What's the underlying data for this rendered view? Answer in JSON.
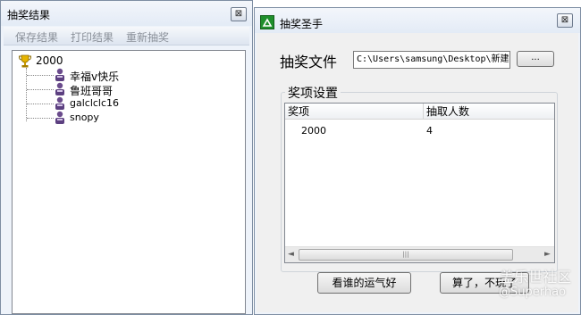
{
  "results_window": {
    "title": "抽奖结果",
    "close_glyph": "⊠",
    "menu": [
      "保存结果",
      "打印结果",
      "重新抽奖"
    ],
    "tree": {
      "root": "2000",
      "root_icon": "trophy-icon",
      "children": [
        "幸福v快乐",
        "鲁班哥哥",
        "galclclc16",
        "snopy"
      ],
      "child_icon": "user-icon"
    }
  },
  "main_window": {
    "title": "抽奖圣手",
    "close_glyph": "⊠",
    "file_label": "抽奖文件",
    "file_path": "C:\\Users\\samsung\\Desktop\\新建",
    "browse_label": "...",
    "group_title": "奖项设置",
    "columns": [
      "奖项",
      "抽取人数"
    ],
    "rows": [
      {
        "prize": "2000",
        "count": "4"
      }
    ],
    "scroll_left": "◄",
    "scroll_right": "►",
    "scroll_grip": "|||",
    "button_luck": "看谁的运气好",
    "button_forget": "算了，不玩了"
  },
  "watermark": {
    "site": "盖乐世社区",
    "user": "@Superhao"
  }
}
